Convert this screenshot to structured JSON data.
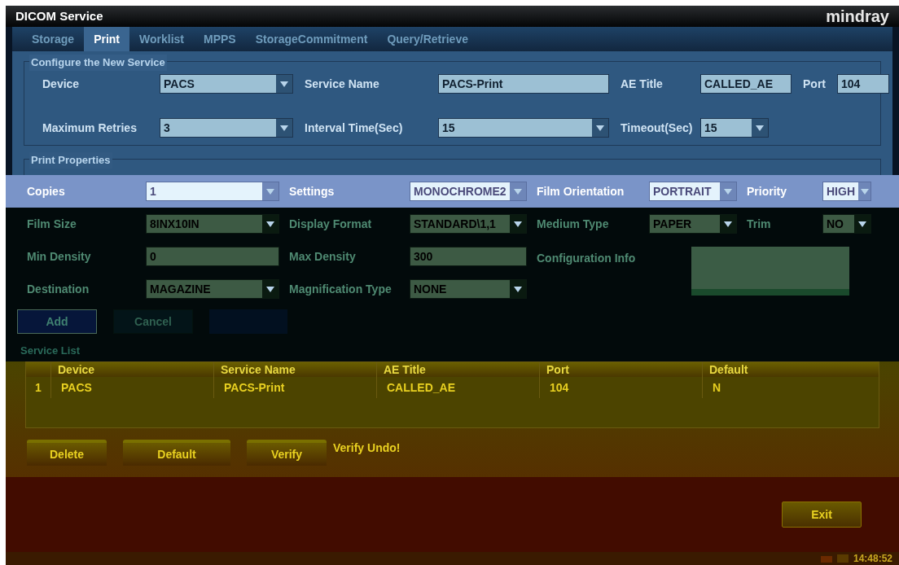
{
  "window": {
    "title": "DICOM Service",
    "logo": "mindray"
  },
  "tabs": [
    {
      "label": "Storage",
      "selected": false
    },
    {
      "label": "Print",
      "selected": true
    },
    {
      "label": "Worklist",
      "selected": false
    },
    {
      "label": "MPPS",
      "selected": false
    },
    {
      "label": "StorageCommitment",
      "selected": false
    },
    {
      "label": "Query/Retrieve",
      "selected": false
    }
  ],
  "configure": {
    "title": "Configure the New Service",
    "rows": [
      [
        {
          "label": "Device",
          "value": "PACS",
          "kind": "dropdown"
        },
        {
          "label": "Service Name",
          "value": "PACS-Print",
          "kind": "text"
        },
        {
          "label": "AE Title",
          "value": "CALLED_AE",
          "kind": "text"
        },
        {
          "label": "Port",
          "value": "104",
          "kind": "text"
        }
      ],
      [
        {
          "label": "Maximum Retries",
          "value": "3",
          "kind": "dropdown"
        },
        {
          "label": "Interval Time(Sec)",
          "value": "15",
          "kind": "dropdown"
        },
        {
          "label": "Timeout(Sec)",
          "value": "15",
          "kind": "dropdown"
        }
      ]
    ]
  },
  "print_properties": {
    "title": "Print Properties",
    "rows": [
      [
        {
          "label": "Copies",
          "value": "1",
          "kind": "dropdown"
        },
        {
          "label": "Settings",
          "value": "MONOCHROME2",
          "kind": "dropdown"
        },
        {
          "label": "Film Orientation",
          "value": "PORTRAIT",
          "kind": "dropdown"
        },
        {
          "label": "Priority",
          "value": "HIGH",
          "kind": "dropdown"
        }
      ],
      [
        {
          "label": "Film Size",
          "value": "8INX10IN",
          "kind": "dropdown"
        },
        {
          "label": "Display Format",
          "value": "STANDARD\\1,1",
          "kind": "dropdown"
        },
        {
          "label": "Medium Type",
          "value": "PAPER",
          "kind": "dropdown"
        },
        {
          "label": "Trim",
          "value": "NO",
          "kind": "dropdown"
        }
      ],
      [
        {
          "label": "Min Density",
          "value": "0",
          "kind": "text"
        },
        {
          "label": "Max Density",
          "value": "300",
          "kind": "text"
        },
        {
          "label": "Configuration Info",
          "kind": "textarea"
        }
      ],
      [
        {
          "label": "Destination",
          "value": "MAGAZINE",
          "kind": "dropdown"
        },
        {
          "label": "Magnification Type",
          "value": "NONE",
          "kind": "dropdown"
        }
      ]
    ]
  },
  "form_buttons": [
    "Add",
    "Cancel"
  ],
  "service_list": {
    "title": "Service List",
    "columns": [
      "Device",
      "Service Name",
      "AE Title",
      "Port",
      "Default"
    ],
    "rows": [
      {
        "index": "1",
        "cells": [
          "PACS",
          "PACS-Print",
          "CALLED_AE",
          "104",
          "N"
        ]
      }
    ]
  },
  "list_buttons": [
    "Delete",
    "Default",
    "Verify"
  ],
  "verify_message": "Verify Undo!",
  "exit_button": "Exit",
  "status_bar": {
    "time": "14:48:52"
  }
}
